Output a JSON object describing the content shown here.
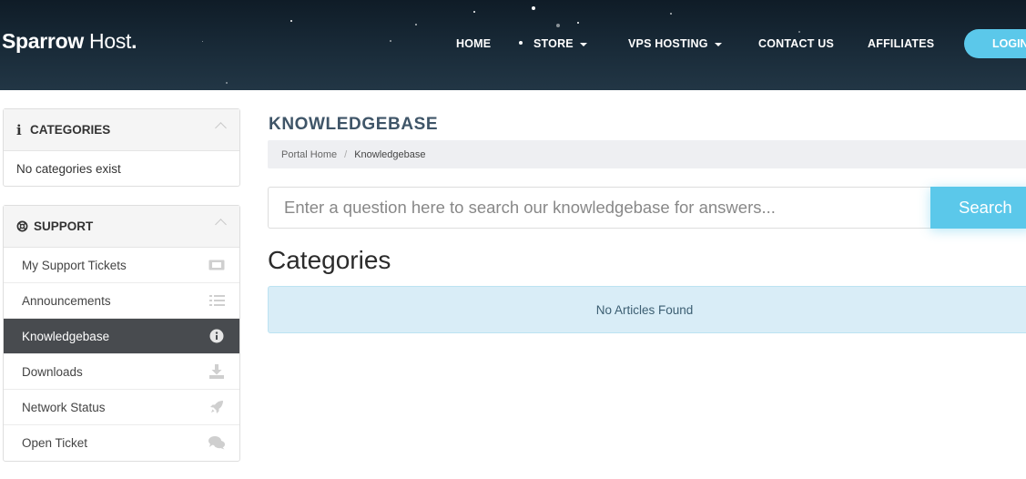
{
  "header": {
    "logo_bold": "Sparrow",
    "logo_regular": " Host",
    "logo_dot": ".",
    "nav": [
      {
        "label": "HOME",
        "has_caret": false
      },
      {
        "label": "STORE",
        "has_caret": true
      },
      {
        "label": "VPS HOSTING",
        "has_caret": true
      },
      {
        "label": "CONTACT US",
        "has_caret": false
      },
      {
        "label": "AFFILIATES",
        "has_caret": false
      }
    ],
    "login_label": "LOGIN",
    "accent_color": "#5bc8ea"
  },
  "sidebar": {
    "categories_panel": {
      "title": "CATEGORIES",
      "icon": "info-icon",
      "empty_text": "No categories exist"
    },
    "support_panel": {
      "title": "SUPPORT",
      "icon": "lifebuoy-icon",
      "items": [
        {
          "label": "My Support Tickets",
          "icon": "ticket-icon",
          "active": false
        },
        {
          "label": "Announcements",
          "icon": "list-icon",
          "active": false
        },
        {
          "label": "Knowledgebase",
          "icon": "info-circle-icon",
          "active": true
        },
        {
          "label": "Downloads",
          "icon": "download-icon",
          "active": false
        },
        {
          "label": "Network Status",
          "icon": "rocket-icon",
          "active": false
        },
        {
          "label": "Open Ticket",
          "icon": "comments-icon",
          "active": false
        }
      ]
    }
  },
  "main": {
    "page_title": "KNOWLEDGEBASE",
    "breadcrumb": [
      "Portal Home",
      "Knowledgebase"
    ],
    "search": {
      "placeholder": "Enter a question here to search our knowledgebase for answers...",
      "button_label": "Search"
    },
    "categories_heading": "Categories",
    "empty_message": "No Articles Found"
  }
}
